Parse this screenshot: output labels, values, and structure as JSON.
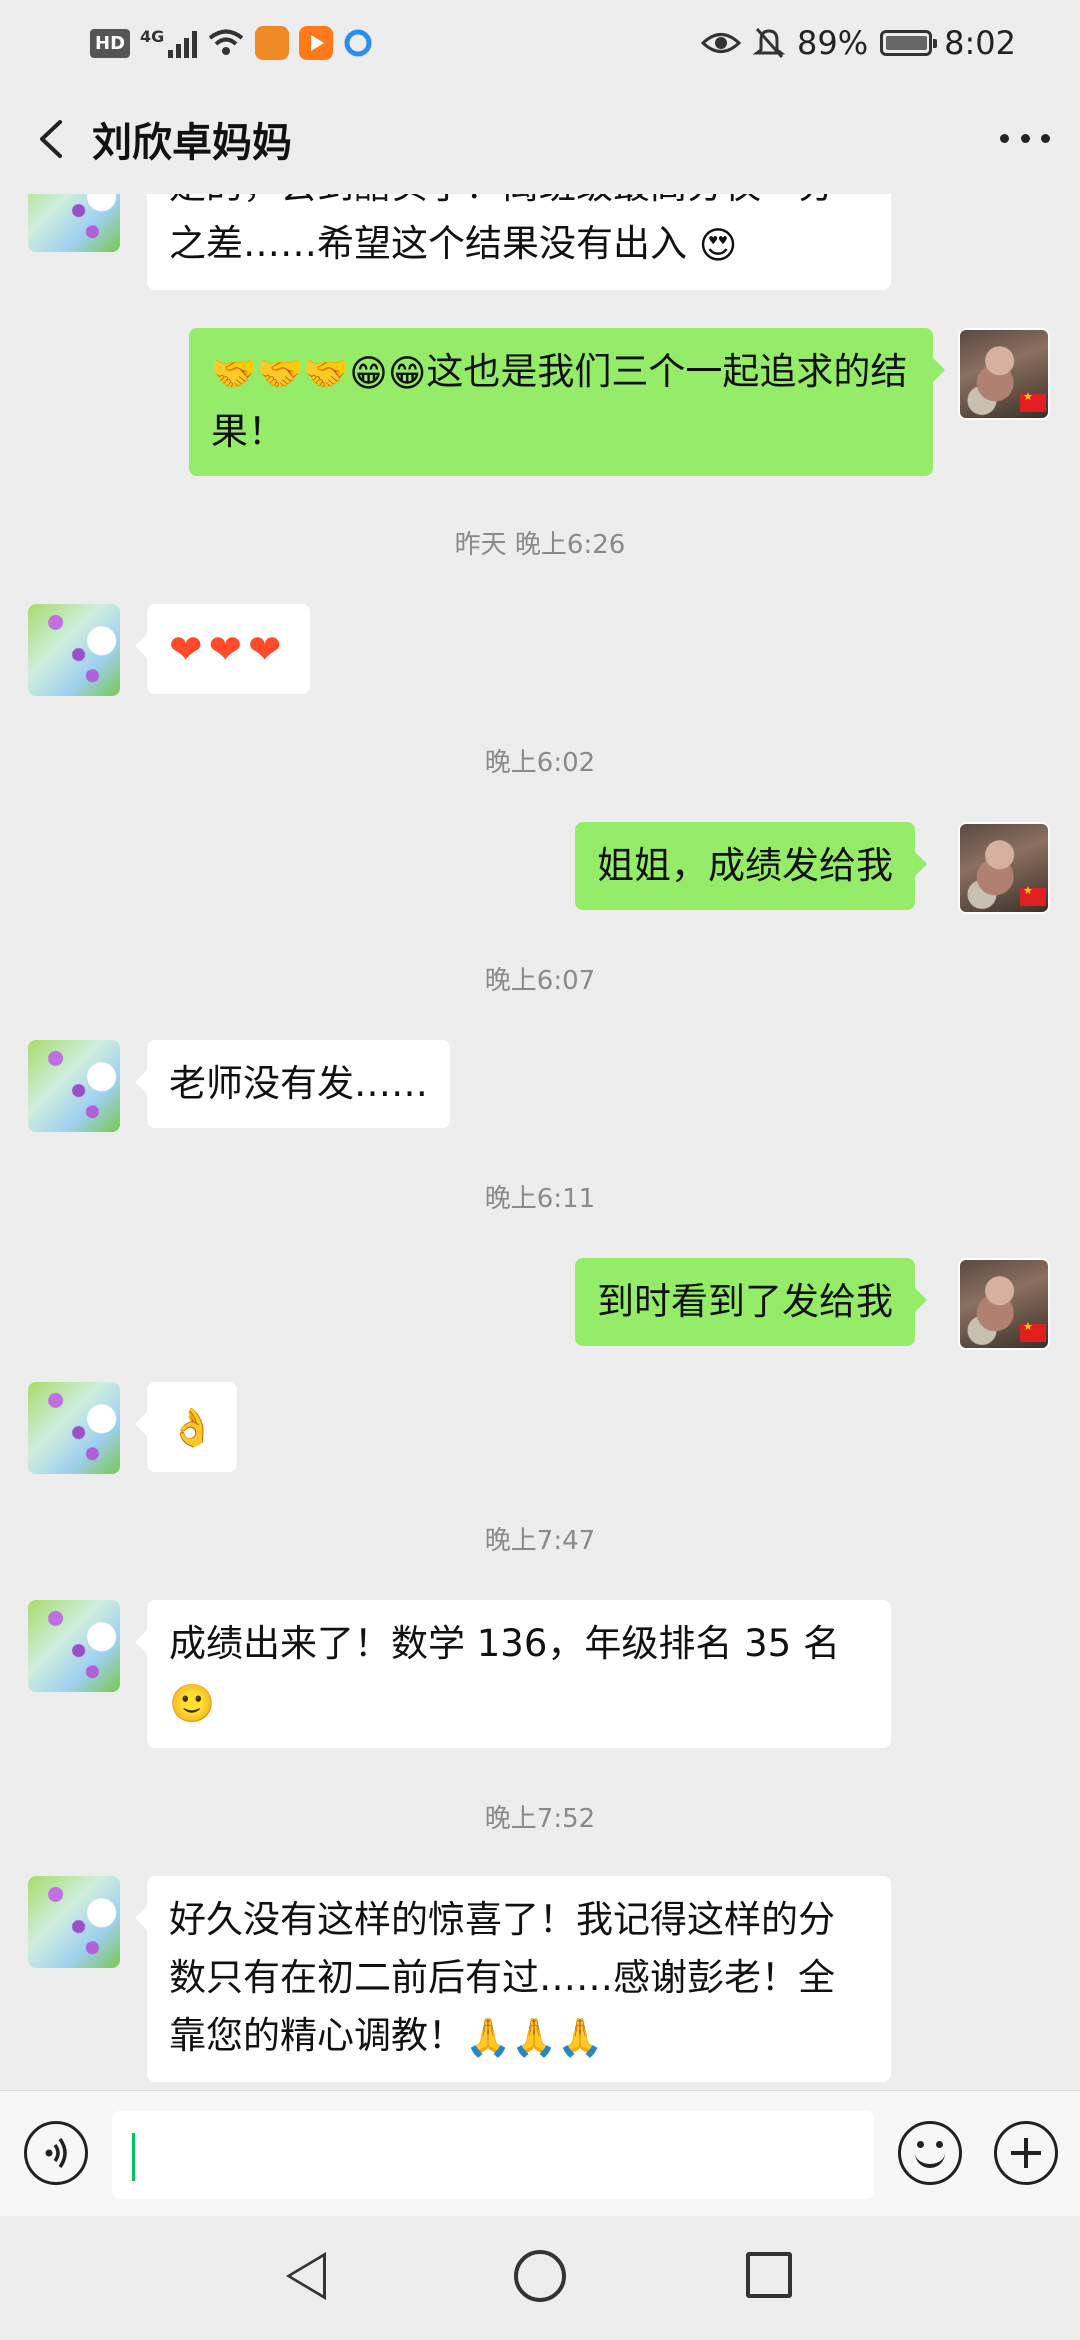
{
  "status_bar": {
    "hd": "HD",
    "network": "4G",
    "battery": "89%",
    "time": "8:02"
  },
  "header": {
    "title": "刘欣卓妈妈"
  },
  "messages": {
    "m1_text": "是的，会到醋实了！离班级最高分仅一分之差……希望这个结果没有出入",
    "m2_text": "这也是我们三个一起追求的结果！",
    "t1": "昨天 晚上6:26",
    "t2": "晚上6:02",
    "m4_text": "姐姐，成绩发给我",
    "t3": "晚上6:07",
    "m5_text": "老师没有发……",
    "t4": "晚上6:11",
    "m6_text": "到时看到了发给我",
    "t5": "晚上7:47",
    "m8_text": "成绩出来了！数学 136，年级排名 35 名",
    "t6": "晚上7:52",
    "m9_text": "好久没有这样的惊喜了！我记得这样的分数只有在初二前后有过……感谢彭老！全靠您的精心调教！"
  },
  "icons": {
    "handshake": "🤝",
    "grin": "😁",
    "heart": "❤",
    "ok_hand": "👌",
    "smile": "🙂",
    "heart_eyes": "😍",
    "pray": "🙏"
  },
  "colors": {
    "outgoing_bubble": "#95ec69",
    "incoming_bubble": "#ffffff",
    "background": "#ededed",
    "cursor": "#07c160"
  }
}
